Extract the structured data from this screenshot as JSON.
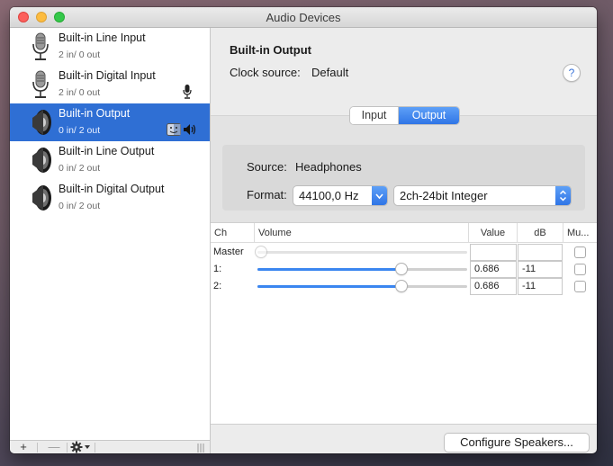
{
  "window": {
    "title": "Audio Devices"
  },
  "devices": [
    {
      "name": "Built-in Line Input",
      "io": "2 in/ 0 out",
      "icon": "microphone-icon",
      "selected": false
    },
    {
      "name": "Built-in Digital Input",
      "io": "2 in/ 0 out",
      "icon": "microphone-icon",
      "selected": false,
      "badge": "default-input-mic-icon"
    },
    {
      "name": "Built-in Output",
      "io": "0 in/ 2 out",
      "icon": "speaker-icon",
      "selected": true,
      "badges": [
        "finder-icon",
        "default-output-speaker-icon"
      ]
    },
    {
      "name": "Built-in Line Output",
      "io": "0 in/ 2 out",
      "icon": "speaker-icon",
      "selected": false
    },
    {
      "name": "Built-in Digital Output",
      "io": "0 in/ 2 out",
      "icon": "speaker-icon",
      "selected": false
    }
  ],
  "sidebar_bottom": {
    "add": "+",
    "remove": "—"
  },
  "detail": {
    "title": "Built-in Output",
    "clock_label": "Clock source:",
    "clock_value": "Default",
    "help": "?",
    "tabs": [
      "Input",
      "Output"
    ],
    "active_tab": "Output",
    "source_label": "Source:",
    "source_value": "Headphones",
    "format_label": "Format:",
    "sample_rate": "44100,0 Hz",
    "format": "2ch-24bit Integer"
  },
  "table": {
    "headers": [
      "Ch",
      "Volume",
      "Value",
      "dB",
      "Mu..."
    ],
    "rows": [
      {
        "ch": "Master",
        "volume": 0,
        "value": "",
        "db": "",
        "muted": false,
        "enabled": false
      },
      {
        "ch": "1:",
        "volume": 0.686,
        "value": "0.686",
        "db": "-11",
        "muted": false,
        "enabled": true
      },
      {
        "ch": "2:",
        "volume": 0.686,
        "value": "0.686",
        "db": "-11",
        "muted": false,
        "enabled": true
      }
    ]
  },
  "configure_button": "Configure Speakers...",
  "colors": {
    "selection": "#2f6fd4",
    "accent": "#3b86f0"
  }
}
